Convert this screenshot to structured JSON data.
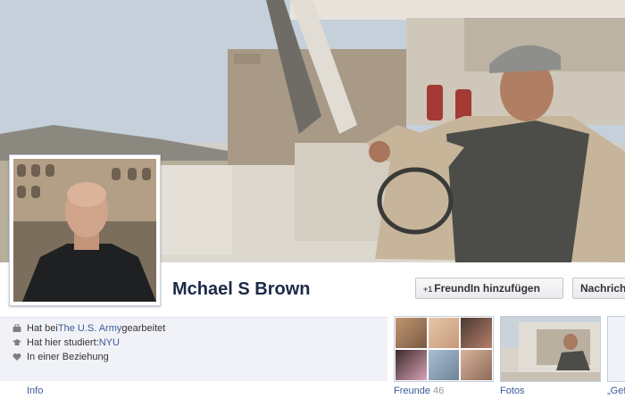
{
  "profile": {
    "name": "Mchael S Brown",
    "add_friend_label": "FreundIn hinzufügen",
    "add_friend_prefix": "+1",
    "message_label": "Nachricht"
  },
  "info": {
    "work_prefix": "Hat bei ",
    "work_link": "The U.S. Army",
    "work_suffix": " gearbeitet",
    "study_prefix": "Hat hier studiert: ",
    "study_link": "NYU",
    "relationship": "In einer Beziehung"
  },
  "tabs": {
    "info": "Info",
    "friends": "Freunde",
    "friends_count": "46",
    "photos": "Fotos",
    "next": "„Gef"
  },
  "icons": {
    "work": "briefcase-icon",
    "study": "graduation-cap-icon",
    "relationship": "heart-icon"
  },
  "colors": {
    "brand_link": "#3b5998",
    "name_color": "#1c2a47",
    "info_bg": "#f0f2f7"
  }
}
